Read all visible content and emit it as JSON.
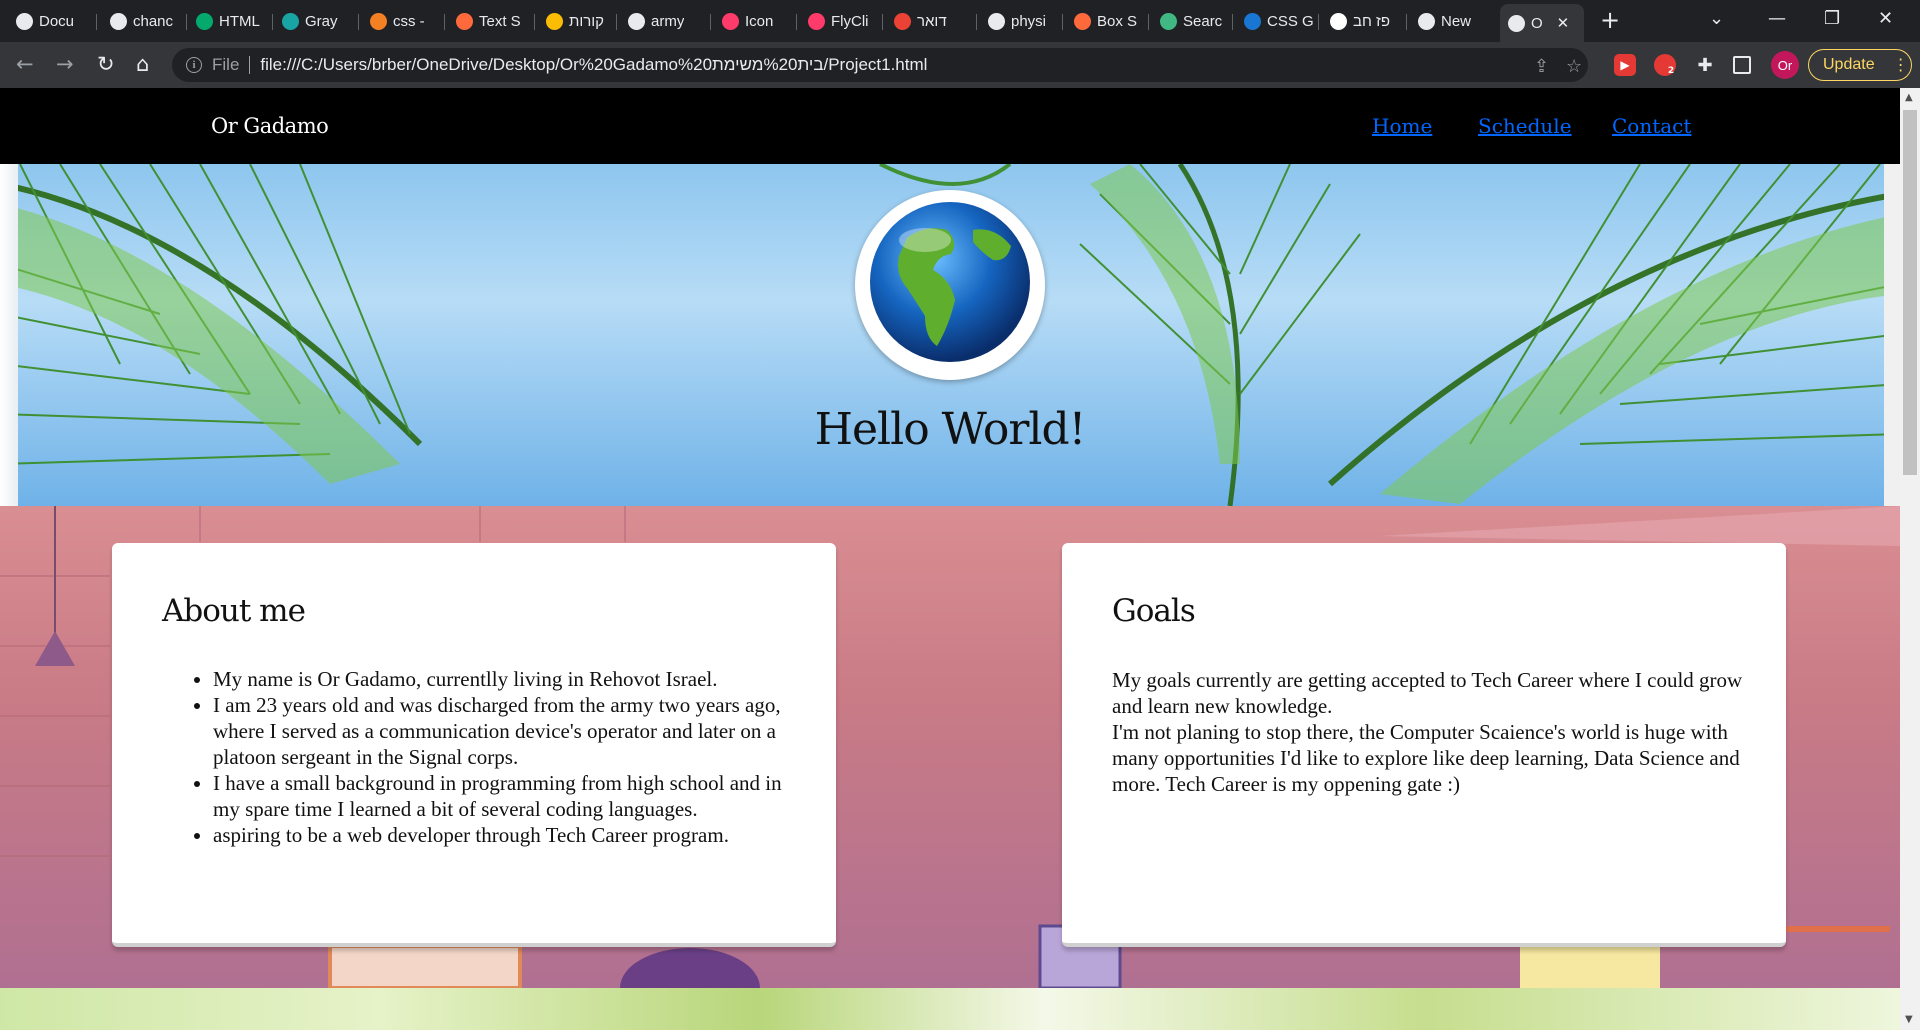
{
  "browser": {
    "tabs": [
      {
        "label": "Docu",
        "icon": "chrome-icon",
        "color": "#e8eaed"
      },
      {
        "label": "chanc",
        "icon": "google-icon",
        "color": "#e8eaed"
      },
      {
        "label": "HTML",
        "icon": "w3schools-icon",
        "color": "#04aa6d"
      },
      {
        "label": "Gray",
        "icon": "doc-icon",
        "color": "#1aa5a5"
      },
      {
        "label": "css - ",
        "icon": "stackoverflow-icon",
        "color": "#f48024"
      },
      {
        "label": "Text S",
        "icon": "box-icon",
        "color": "#ff6a3d"
      },
      {
        "label": "קורות",
        "icon": "drive-icon",
        "color": "#fbbc04"
      },
      {
        "label": "army",
        "icon": "google-icon",
        "color": "#e8eaed"
      },
      {
        "label": "Icon ",
        "icon": "flycricket-icon",
        "color": "#ff3b6b"
      },
      {
        "label": "FlyCli",
        "icon": "flycricket-icon",
        "color": "#ff3b6b"
      },
      {
        "label": "דואר",
        "icon": "gmail-icon",
        "color": "#ea4335"
      },
      {
        "label": "physi",
        "icon": "google-icon",
        "color": "#e8eaed"
      },
      {
        "label": "Box S",
        "icon": "box-icon",
        "color": "#ff6a3d"
      },
      {
        "label": "Searc",
        "icon": "vue-icon",
        "color": "#41b883"
      },
      {
        "label": "CSS G",
        "icon": "globe-icon",
        "color": "#1976d2"
      },
      {
        "label": "פז חב",
        "icon": "wikipedia-icon",
        "color": "#ffffff"
      },
      {
        "label": "New",
        "icon": "chrome-icon",
        "color": "#e8eaed"
      },
      {
        "label": "O",
        "icon": "globe-icon",
        "color": "#e8eaed",
        "active": true
      }
    ],
    "address": {
      "scheme": "File",
      "url": "file:///C:/Users/brber/OneDrive/Desktop/Or%20Gadamo%20בית%20משימת/Project1.html"
    },
    "profile_initials": "Or",
    "update_label": "Update",
    "extension_badge": "2"
  },
  "site": {
    "brand": "Or Gadamo",
    "nav": [
      "Home",
      "Schedule",
      "Contact"
    ],
    "hero_title": "Hello World!",
    "about": {
      "title": "About me",
      "items": [
        "My name is Or Gadamo, currentlly living in Rehovot Israel.",
        "I am 23 years old and was discharged from the army two years ago, where I served as a communication device's operator and later on a platoon sergeant in the Signal corps.",
        "I have a small background in programming from high school and in my spare time I learned a bit of several coding languages.",
        "aspiring to be a web developer through Tech Career program."
      ]
    },
    "goals": {
      "title": "Goals",
      "line1": "My goals currently are getting accepted to Tech Career where I could grow and learn new knowledge.",
      "line2": "I'm not planing to stop there, the Computer Scaience's world is huge with many opportunities I'd like to explore like deep learning, Data Science and more. Tech Career is my oppening gate :)"
    }
  }
}
